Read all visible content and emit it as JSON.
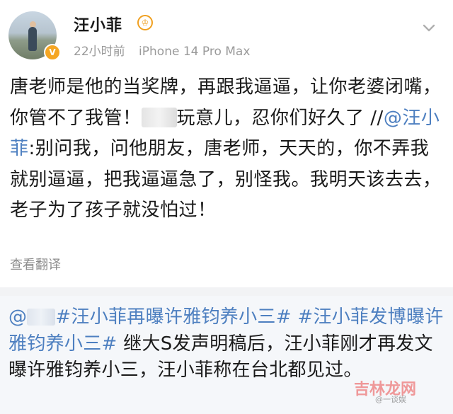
{
  "post": {
    "author": "汪小菲",
    "time": "22小时前",
    "device": "iPhone 14 Pro Max",
    "text_part1": "唐老师是他的当奖牌，再跟我逼逼，让你老婆闭嘴，你管不了我管！",
    "text_part2": "玩意儿，忍你们好久了 //",
    "mention": "@汪小菲",
    "text_part3": ":别问我，问他朋友，唐老师，天天的，你不弄我就别逼逼，把我逼逼急了，别怪我。我明天该去去，老子为了孩子就没怕过！",
    "translate": "查看翻译"
  },
  "quote": {
    "prefix": "@",
    "tag1": "#汪小菲再曝许雅钧养小三#",
    "tag2": "#汪小菲发博曝许雅钧养小三#",
    "text": "继大S发声明稿后，汪小菲刚才再发文曝许雅钧养小三，汪小菲称在台北都见过。"
  },
  "watermark": {
    "text": "吉林龙网",
    "sub": "@一谈娱"
  },
  "colors": {
    "mention": "#4d7fc0",
    "meta": "#9a9a9a",
    "badge": "#f5a623"
  }
}
